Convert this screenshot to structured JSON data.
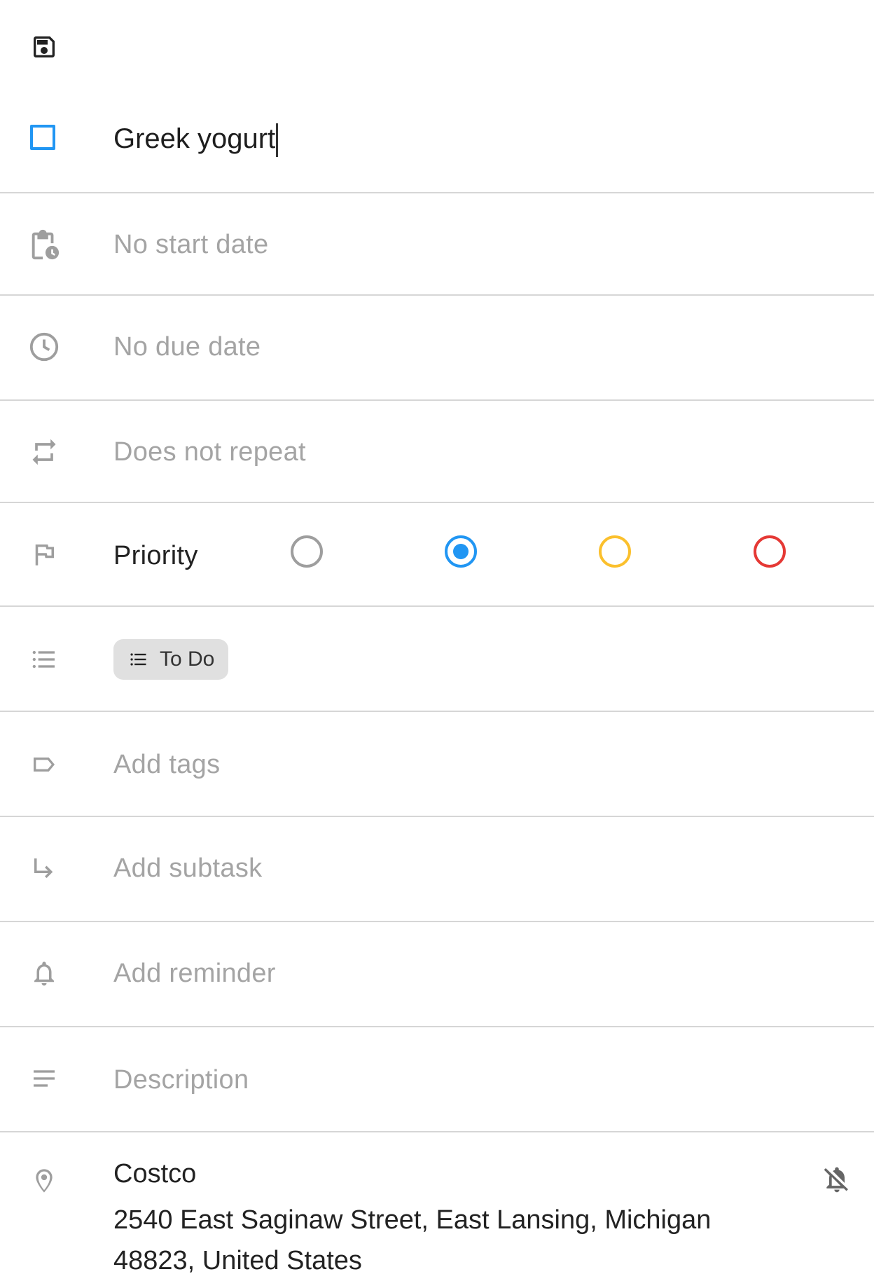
{
  "toolbar": {
    "save_icon": "save-icon"
  },
  "task": {
    "title": "Greek yogurt",
    "checkbox_color": "#2196f3"
  },
  "fields": {
    "start_date": "No start date",
    "due_date": "No due date",
    "repeat": "Does not repeat",
    "priority_label": "Priority",
    "list_chip": "To Do",
    "tags": "Add tags",
    "subtask": "Add subtask",
    "reminder": "Add reminder",
    "description": "Description"
  },
  "priority": {
    "options": [
      {
        "name": "none",
        "color": "#9e9e9e"
      },
      {
        "name": "low",
        "color": "#2196f3"
      },
      {
        "name": "medium",
        "color": "#fbc02d"
      },
      {
        "name": "high",
        "color": "#e53935"
      }
    ],
    "selected": "low"
  },
  "location": {
    "name": "Costco",
    "address": "2540 East Saginaw Street, East Lansing, Michigan 48823, United States",
    "notification_icon": "notifications-off-icon"
  },
  "colors": {
    "accent": "#2196f3",
    "placeholder": "#a4a4a4",
    "divider": "#d6d6d6",
    "icon": "#9e9e9e"
  }
}
